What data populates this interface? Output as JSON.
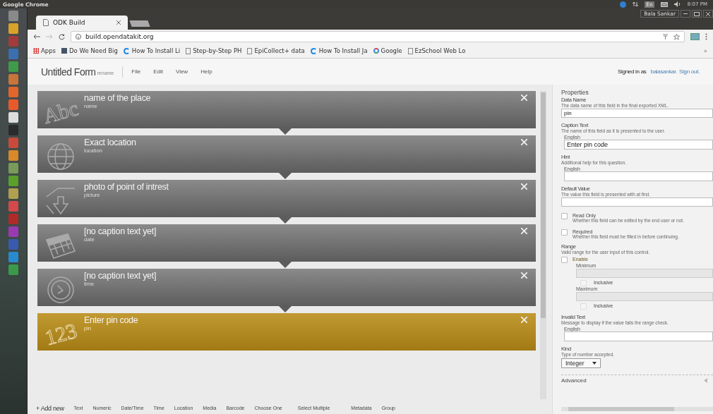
{
  "os_bar": {
    "title": "Google Chrome",
    "keyboard": "En",
    "time": "8:07 PM",
    "user": "Bala Sankar"
  },
  "browser": {
    "tab": {
      "title": "ODK Build"
    },
    "url": "build.opendatakit.org",
    "overflow": "»",
    "bookmarks": [
      {
        "kind": "apps",
        "label": "Apps"
      },
      {
        "kind": "image",
        "label": "Do We Need Big"
      },
      {
        "kind": "sync",
        "label": "How To Install Li"
      },
      {
        "kind": "page",
        "label": "Step-by-Step PH"
      },
      {
        "kind": "page",
        "label": "EpiCollect+ data"
      },
      {
        "kind": "sync",
        "label": "How To Install Ja"
      },
      {
        "kind": "google",
        "label": "Google"
      },
      {
        "kind": "page",
        "label": "EzSchool Web Lo"
      }
    ]
  },
  "app_header": {
    "form_title": "Untitled Form",
    "rename": "rename",
    "menu": [
      "File",
      "Edit",
      "View",
      "Help"
    ],
    "signed_in_prefix": "Signed in as",
    "user": "balasankar.",
    "sign_out": "Sign out."
  },
  "fields": [
    {
      "kind": "text",
      "icon_text": "Abc",
      "caption": "name of the place",
      "name": "name",
      "selected": false
    },
    {
      "kind": "location",
      "caption": "Exact location",
      "name": "location",
      "selected": false
    },
    {
      "kind": "image",
      "caption": "photo of point of intrest",
      "name": "picture",
      "selected": false
    },
    {
      "kind": "date",
      "caption": "[no caption text yet]",
      "name": "date",
      "selected": false
    },
    {
      "kind": "time",
      "caption": "[no caption text yet]",
      "name": "time",
      "selected": false
    },
    {
      "kind": "number",
      "icon_text": "123",
      "caption": "Enter pin code",
      "name": "pin",
      "selected": true
    }
  ],
  "properties": {
    "title": "Properties",
    "advanced": "Advanced",
    "sections": [
      {
        "kind": "input",
        "label": "Data Name",
        "description": "The data name of this field in the final exported XML.",
        "value": "pin"
      },
      {
        "kind": "localized",
        "label": "Caption Text",
        "description": "The name of this field as it is presented to the user.",
        "language": "English",
        "value": "Enter pin code"
      },
      {
        "kind": "localized",
        "label": "Hint",
        "description": "Additional help for this question.",
        "language": "English"
      },
      {
        "kind": "input",
        "label": "Default Value",
        "description": "The value this field is presented with at first."
      },
      {
        "kind": "checkbox",
        "label": "Read Only",
        "description": "Whether this field can be edited by the end user or not.",
        "checked": false
      },
      {
        "kind": "checkbox",
        "label": "Required",
        "description": "Whether this field must be filled in before continuing.",
        "checked": false
      },
      {
        "kind": "range",
        "label": "Range",
        "description": "Valid range for the user input of this control.",
        "enable": {
          "label": "Enable",
          "checked": false
        },
        "minimum": {
          "label": "Minimum",
          "disabled": true,
          "inclusive": {
            "label": "Inclusive",
            "checked": false
          }
        },
        "maximum": {
          "label": "Maximum",
          "disabled": true,
          "inclusive": {
            "label": "Inclusive",
            "checked": false
          }
        }
      },
      {
        "kind": "localized",
        "label": "Invalid Text",
        "description": "Message to display if the value fails the range check.",
        "language": "English"
      },
      {
        "kind": "select",
        "label": "Kind",
        "description": "Type of number accepted.",
        "value": "Integer"
      }
    ]
  },
  "add_bar": {
    "label": "+ Add new",
    "types": [
      "Text",
      "Numeric",
      "Date/Time",
      "Time",
      "Location",
      "Media",
      "Barcode",
      "Choose One",
      "Select Multiple",
      "Metadata",
      "Group"
    ]
  }
}
